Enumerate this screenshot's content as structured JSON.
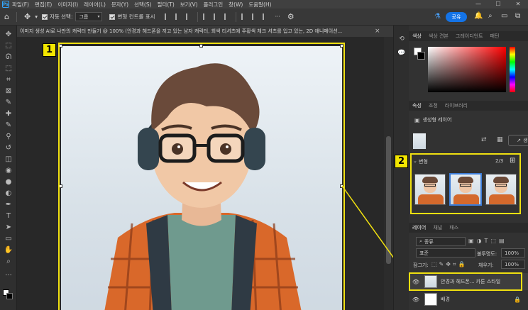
{
  "menubar": {
    "items": [
      "파일(F)",
      "편집(E)",
      "이미지(I)",
      "레이어(L)",
      "문자(Y)",
      "선택(S)",
      "필터(T)",
      "보기(V)",
      "플러그인",
      "창(W)",
      "도움말(H)"
    ],
    "logo": "Ps",
    "window_controls": [
      "—",
      "☐",
      "✕"
    ]
  },
  "options": {
    "auto_select_label": "자동 선택:",
    "auto_select_value": "그룹",
    "transform_label": "변형 컨트롤 표시",
    "share_label": "공유",
    "more": "···"
  },
  "document": {
    "tab_title": "이미지 생성 AI로 나만의 캐릭터 만들기 @ 100% (안경과 헤드폰을 끼고 있는 남자 캐릭터, 회색 티셔츠에 주황색 체크 셔츠를 입고 있는, 2D 애니메이션...",
    "close": "×"
  },
  "callouts": {
    "one": "1",
    "two": "2"
  },
  "color_panel": {
    "tabs": [
      "색상",
      "색상 견본",
      "그레이디언트",
      "패턴"
    ]
  },
  "properties_panel": {
    "tabs": [
      "속성",
      "조정",
      "라이브러리"
    ],
    "layer_type": "생성형 레이어",
    "generate_button": "생성",
    "variations_label": "변형",
    "variations_count": "2/3"
  },
  "layers_panel": {
    "tabs": [
      "레이어",
      "채널",
      "패스"
    ],
    "filter_value": "종류",
    "blend_mode": "표준",
    "opacity_label": "불투명도:",
    "opacity_value": "100%",
    "lock_label": "잠그기:",
    "fill_label": "채우기:",
    "fill_value": "100%",
    "layers": [
      {
        "name": "안경과 헤드폰... 카툰 스타일"
      },
      {
        "name": "배경"
      }
    ]
  },
  "icons": {
    "home": "home-icon",
    "move": "move-icon",
    "settings": "gear-icon",
    "search": "search-icon",
    "bell": "bell-icon"
  }
}
